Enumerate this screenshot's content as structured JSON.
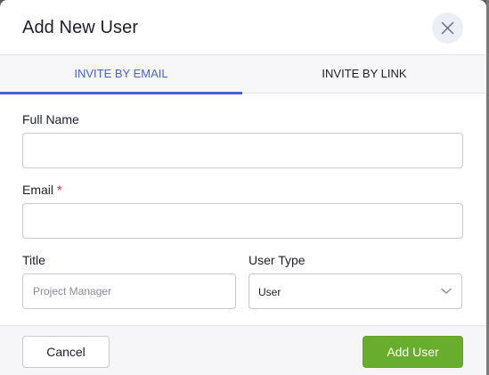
{
  "dialog": {
    "title": "Add New User",
    "close_icon": "close-icon"
  },
  "tabs": [
    {
      "label": "INVITE BY EMAIL",
      "active": true
    },
    {
      "label": "INVITE BY LINK",
      "active": false
    }
  ],
  "form": {
    "full_name": {
      "label": "Full Name",
      "value": "",
      "placeholder": ""
    },
    "email": {
      "label": "Email",
      "required_marker": "*",
      "value": "",
      "placeholder": ""
    },
    "title": {
      "label": "Title",
      "value": "",
      "placeholder": "Project Manager"
    },
    "user_type": {
      "label": "User Type",
      "selected": "User",
      "chevron_icon": "chevron-down-icon"
    }
  },
  "footer": {
    "cancel_label": "Cancel",
    "submit_label": "Add User"
  },
  "colors": {
    "accent": "#4863d8",
    "primary_button": "#6aac2e",
    "required": "#d93025"
  }
}
